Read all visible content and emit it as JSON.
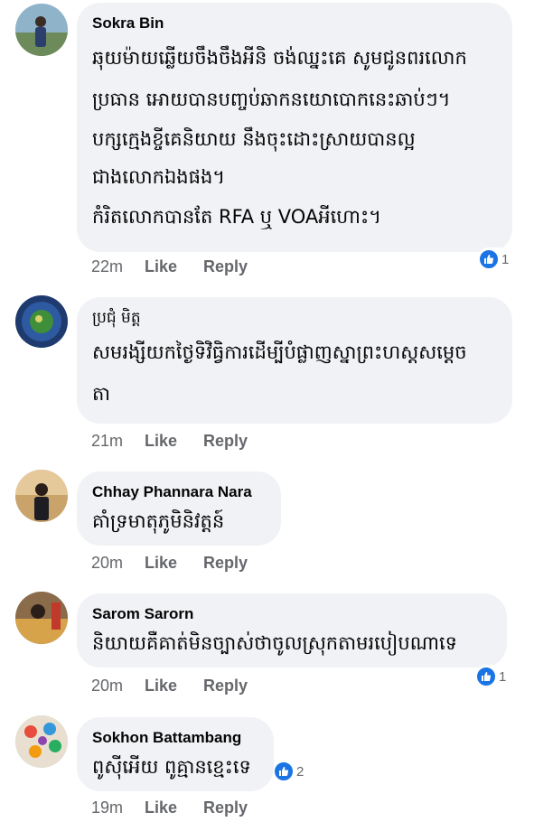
{
  "comments": [
    {
      "author": "Sokra Bin",
      "lines": [
        "ឆុយម៉ាយឆ្លើយចឹងចឹងអីនិ ចង់ឈ្នះគេ សូមជូនពរលោក",
        "ប្រធាន អោយបានបញ្ចប់ឆាកនយោបោកនេះឆាប់ៗ។",
        "បក្សក្មេងខ្ចីគេនិយាយ នឹងចុះដោះស្រាយបានល្អ",
        "ជាងលោកឯងផង។",
        "កំរិតលោកបានតែ RFA ឬ VOAអីហោះ។"
      ],
      "time": "22m",
      "like_label": "Like",
      "reply_label": "Reply",
      "reaction_count": "1",
      "avatar_color": "#6d8a5a"
    },
    {
      "author": "ប្រជុំ មិត្ត",
      "lines": [
        "សមរង្សីយកថ្ងៃទិវិធ្វិការដើម្បីបំផ្លាញស្នាព្រះហស្តសម្តេច",
        "តា"
      ],
      "time": "21m",
      "like_label": "Like",
      "reply_label": "Reply",
      "avatar_color": "#1e3a6e"
    },
    {
      "author": "Chhay Phannara Nara",
      "lines": [
        "គាំទ្រមាតុភូមិនិវត្តន៍"
      ],
      "time": "20m",
      "like_label": "Like",
      "reply_label": "Reply",
      "avatar_color": "#c9a36a"
    },
    {
      "author": "Sarom Sarorn",
      "lines": [
        "និយាយគឺគាត់មិនច្បាស់ថាចូលស្រុកតាមរបៀបណាទេ"
      ],
      "time": "20m",
      "like_label": "Like",
      "reply_label": "Reply",
      "reaction_count": "1",
      "avatar_color": "#8a6b4a"
    },
    {
      "author": "Sokhon Battambang",
      "lines": [
        "ពូស៊ីអើយ ពូគ្មានខ្មេះទេ"
      ],
      "time": "19m",
      "like_label": "Like",
      "reply_label": "Reply",
      "reaction_count": "2",
      "avatar_color": "#e8dfd0"
    }
  ],
  "colors": {
    "bubble": "#f0f2f5",
    "meta_text": "#65676b",
    "like_reaction": "#1b74e4"
  }
}
